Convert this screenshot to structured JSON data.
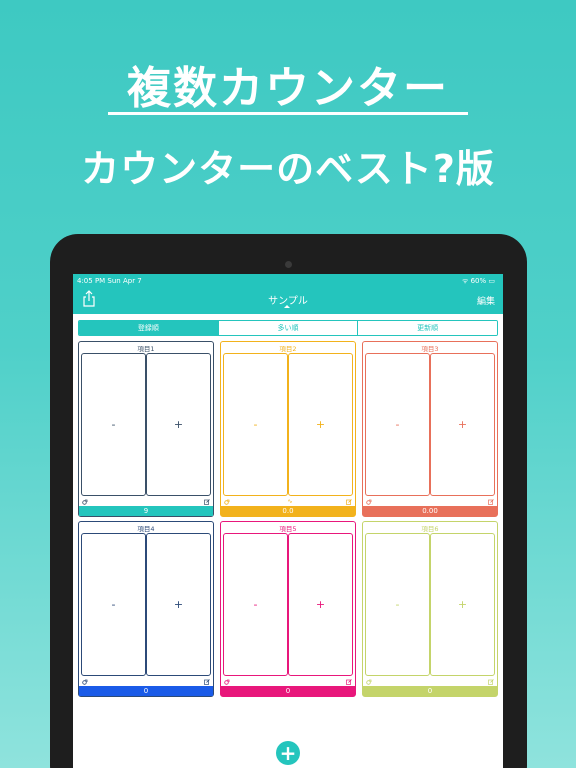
{
  "promo": {
    "title": "複数カウンター",
    "subtitle": "カウンターのベスト?版"
  },
  "status_bar": {
    "time": "4:05 PM   Sun Apr 7",
    "battery": "ᯤ 60% ▭"
  },
  "nav": {
    "title": "サンプル",
    "edit_label": "編集"
  },
  "segments": [
    "登録順",
    "多い順",
    "更新順"
  ],
  "cards": [
    {
      "label": "項目1",
      "minus": "-",
      "plus": "+",
      "value": "9",
      "color": "#24c5bd",
      "border": "#3a5068"
    },
    {
      "label": "項目2",
      "minus": "-",
      "plus": "+",
      "value": "0.0",
      "color": "#f2b21c",
      "border": "#f2b21c"
    },
    {
      "label": "項目3",
      "minus": "-",
      "plus": "+",
      "value": "0.00",
      "color": "#e8705a",
      "border": "#e8705a"
    },
    {
      "label": "項目4",
      "minus": "-",
      "plus": "+",
      "value": "0",
      "color": "#1a5be8",
      "border": "#2c4a78"
    },
    {
      "label": "項目5",
      "minus": "-",
      "plus": "+",
      "value": "0",
      "color": "#e8177b",
      "border": "#e8177b"
    },
    {
      "label": "項目6",
      "minus": "-",
      "plus": "+",
      "value": "0",
      "color": "#c4d46a",
      "border": "#c4d46a"
    }
  ],
  "fab": "+"
}
